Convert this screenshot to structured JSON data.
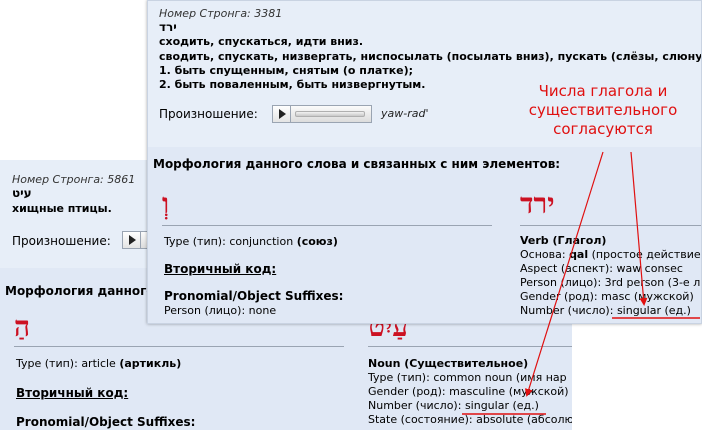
{
  "colors": {
    "hebrew_red": "#cc1122",
    "annotation_red": "#e01010",
    "header_bg": "#e7eef8",
    "morph_bg": "#e0e8f5"
  },
  "back": {
    "strongs": "Номер Стронга: 5861",
    "hebrew": "עיט",
    "definition": "хищные птицы.",
    "pronunciation_label": "Произношение:",
    "morph_title": "Морфология данного",
    "left": {
      "hebrew": "הַ",
      "type_label": "Type (тип):",
      "type_value": "article",
      "type_bold": "(артикль)",
      "secondary": "Вторичный код:",
      "suffixes": "Pronomial/Object Suffixes:"
    },
    "right": {
      "hebrew": "עַיִט",
      "pos": "Noun (Существительное)",
      "rows": [
        {
          "label": "Type (тип):",
          "value": "common noun (имя нар"
        },
        {
          "label": "Gender (род):",
          "value": "masculine (мужской)"
        },
        {
          "label": "Number (число):",
          "value": "singular (ед.)"
        },
        {
          "label": "State (состояние):",
          "value": "absolute (абсолю"
        }
      ]
    }
  },
  "front": {
    "strongs": "Номер Стронга: 3381",
    "hebrew": "ירד",
    "definitions": [
      "сходить, спускаться, идти вниз.",
      "сводить, спускать, низвергать, ниспосылать (посылать вниз), пускать (слёзы, слюну)",
      "1. быть спущенным, снятым (о платке);",
      "2. быть поваленным, быть низвергнутым."
    ],
    "pronunciation_label": "Произношение:",
    "transliteration": "yaw-rad'",
    "morph_title": "Морфология данного слова и связанных с ним элементов:",
    "left": {
      "hebrew": "וְ",
      "type_label": "Type (тип):",
      "type_value": "conjunction",
      "type_bold": "(союз)",
      "secondary": "Вторичный код:",
      "suffixes": "Pronomial/Object Suffixes:",
      "person": "Person (лицо): none"
    },
    "right": {
      "hebrew": "ירד",
      "pos": "Verb (Глагол)",
      "rows": [
        {
          "label": "Основа:",
          "bold": "qal",
          "value": "(простое действие"
        },
        {
          "label": "Aspect (аспект):",
          "bold": "",
          "value": "waw consec"
        },
        {
          "label": "Person (лицо):",
          "bold": "",
          "value": "3rd person (3-е л"
        },
        {
          "label": "Gender (род):",
          "bold": "",
          "value": "masc (мужской)"
        },
        {
          "label": "Number (число):",
          "bold": "",
          "value": "singular (ед.)"
        }
      ]
    }
  },
  "annotation": {
    "lines": [
      "Числа глагола и",
      "существительного",
      "согласуются"
    ]
  }
}
